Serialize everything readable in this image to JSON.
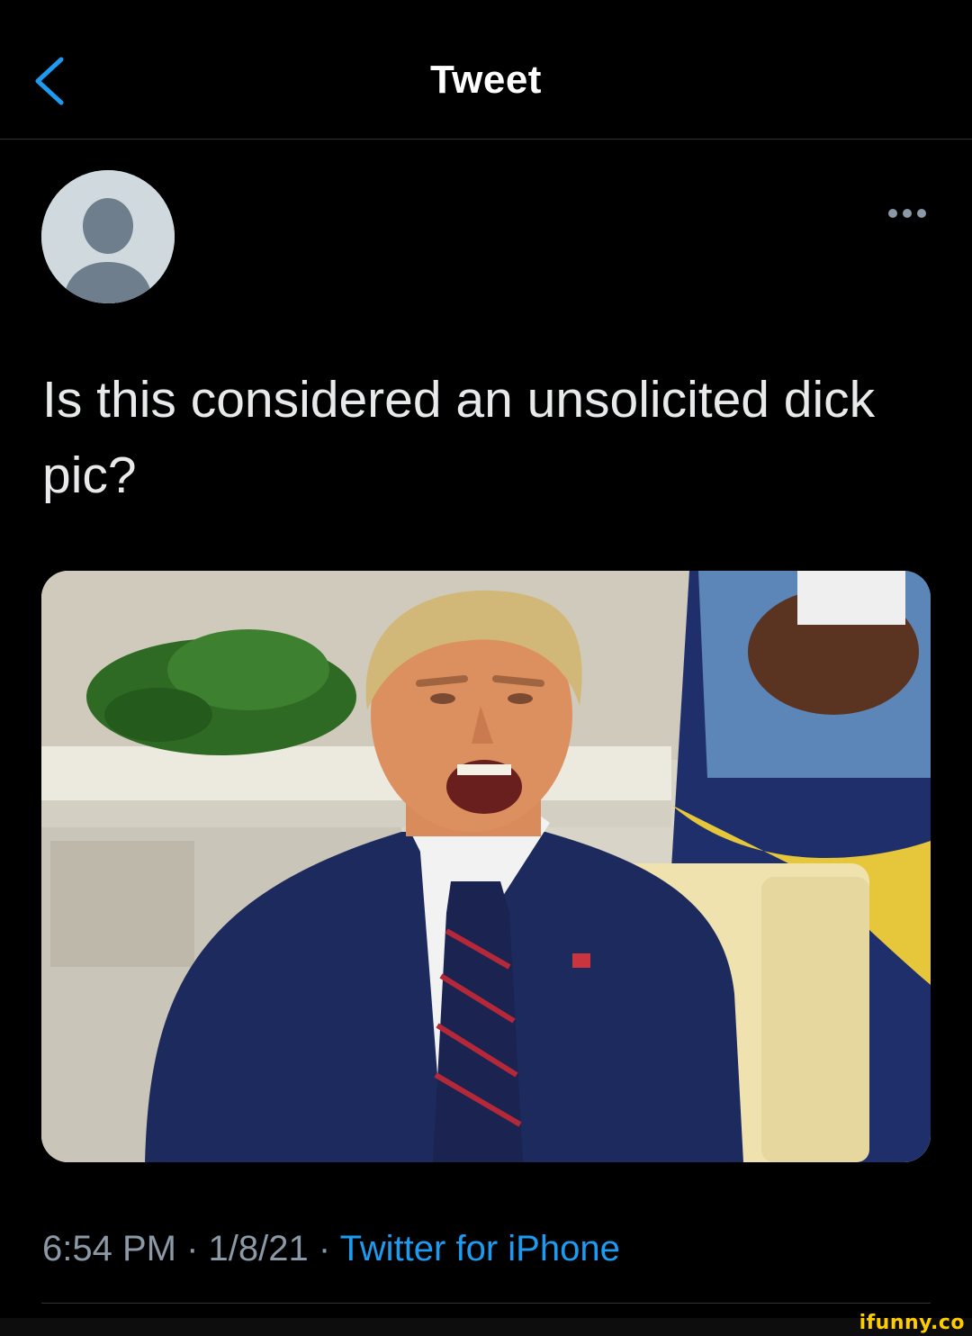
{
  "nav": {
    "title": "Tweet",
    "back_icon": "chevron-left-icon"
  },
  "tweet": {
    "avatar_icon": "default-avatar-icon",
    "more_icon": "ellipsis-icon",
    "text": "Is this considered an unsolicited dick pic?",
    "media_alt": "photo-man-shouting-in-office",
    "time": "6:54 PM",
    "separator": " · ",
    "date": "1/8/21",
    "source": "Twitter for iPhone"
  },
  "watermark": {
    "logo": "ifunny.co"
  },
  "colors": {
    "background": "#000000",
    "text": "#e7e9ea",
    "secondary": "#8b98a5",
    "accent": "#1d9bf0",
    "divider": "#2f3336",
    "watermark": "#ffcc00"
  }
}
